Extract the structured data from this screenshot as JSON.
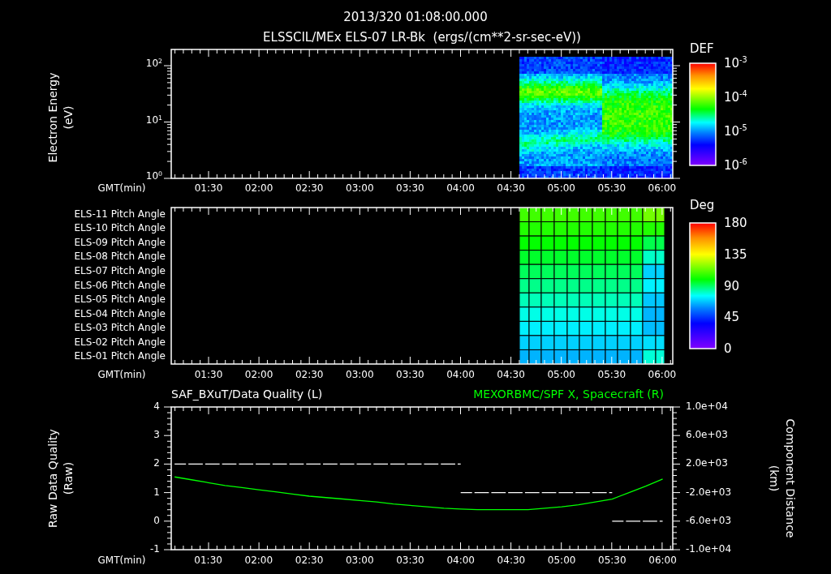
{
  "header": {
    "time": "2013/320 01:08:00.000"
  },
  "energy_panel": {
    "title": "ELSSCIL/MEx ELS-07 LR-Bk  (ergs/(cm**2-sr-sec-eV))",
    "ylabel": "Electron Energy",
    "yunit": "(eV)",
    "yticks": [
      "10$^{2}$",
      "10$^{1}$",
      "10$^{0}$"
    ],
    "xlabel": "GMT(min)",
    "xticks": [
      "01:30",
      "02:00",
      "02:30",
      "03:00",
      "03:30",
      "04:00",
      "04:30",
      "05:00",
      "05:30",
      "06:00"
    ],
    "colorbar": {
      "title": "DEF",
      "ticks": [
        "10$^{-3}$",
        "10$^{-4}$",
        "10$^{-5}$",
        "10$^{-6}$"
      ]
    }
  },
  "pitch_panel": {
    "rows": [
      "ELS-11 Pitch Angle",
      "ELS-10 Pitch Angle",
      "ELS-09 Pitch Angle",
      "ELS-08 Pitch Angle",
      "ELS-07 Pitch Angle",
      "ELS-06 Pitch Angle",
      "ELS-05 Pitch Angle",
      "ELS-04 Pitch Angle",
      "ELS-03 Pitch Angle",
      "ELS-02 Pitch Angle",
      "ELS-01 Pitch Angle"
    ],
    "xlabel": "GMT(min)",
    "xticks": [
      "01:30",
      "02:00",
      "02:30",
      "03:00",
      "03:30",
      "04:00",
      "04:30",
      "05:00",
      "05:30",
      "06:00"
    ],
    "colorbar": {
      "title": "Deg",
      "ticks": [
        "180",
        "135",
        "90",
        "45",
        "0"
      ]
    }
  },
  "quality_panel": {
    "left": {
      "unit": "(Raw)",
      "chart_data": {
        "type": "line",
        "xlabel": "GMT(min)",
        "ylabel": "Raw Data Quality",
        "x": [
          70,
          80,
          90,
          100,
          110,
          120,
          130,
          140,
          150,
          160,
          170,
          180,
          190,
          200,
          210,
          220,
          230,
          240,
          250,
          260,
          270,
          280,
          290,
          300,
          310,
          320,
          330,
          340,
          350
        ],
        "xlim": [
          68,
          366
        ],
        "ylim": [
          -1,
          4
        ],
        "xticks": [
          {
            "value": 90,
            "label": "01:30"
          },
          {
            "value": 120,
            "label": "02:00"
          },
          {
            "value": 150,
            "label": "02:30"
          },
          {
            "value": 180,
            "label": "03:00"
          },
          {
            "value": 210,
            "label": "03:30"
          },
          {
            "value": 240,
            "label": "04:00"
          },
          {
            "value": 270,
            "label": "04:30"
          },
          {
            "value": 300,
            "label": "05:00"
          },
          {
            "value": 330,
            "label": "05:30"
          },
          {
            "value": 360,
            "label": "06:00"
          }
        ],
        "yticks": [
          4,
          3,
          2,
          1,
          0,
          -1
        ],
        "series": [
          {
            "name": "SAF_BXuT/Data Quality (L)",
            "color": "#ffffff",
            "line_style": "dashed",
            "values": [
              2,
              2,
              2,
              2,
              2,
              2,
              2,
              2,
              2,
              2,
              2,
              2,
              2,
              2,
              2,
              2,
              2,
              1,
              1,
              1,
              1,
              1,
              1,
              1,
              1,
              1,
              0,
              0,
              0
            ]
          }
        ]
      }
    },
    "right": {
      "unit": "(km)",
      "chart_data": {
        "type": "line",
        "ylabel": "Component Distance",
        "x": [
          70,
          80,
          90,
          100,
          110,
          120,
          130,
          140,
          150,
          160,
          170,
          180,
          190,
          200,
          210,
          220,
          230,
          240,
          250,
          260,
          270,
          280,
          290,
          300,
          310,
          320,
          330,
          340,
          350,
          360
        ],
        "xlim": [
          68,
          366
        ],
        "ylim": [
          -10000,
          10000
        ],
        "yticks": [
          {
            "value": 10000,
            "label": "1.0e+04"
          },
          {
            "value": 6000,
            "label": "6.0e+03"
          },
          {
            "value": 2000,
            "label": "2.0e+03"
          },
          {
            "value": -2000,
            "label": "-2.0e+03"
          },
          {
            "value": -6000,
            "label": "-6.0e+03"
          },
          {
            "value": -10000,
            "label": "-1.0e+04"
          }
        ],
        "series": [
          {
            "name": "MEXORBMC/SPF X, Spacecraft (R)",
            "color": "#00ff00",
            "line_style": "solid",
            "values": [
              200,
              -200,
              -600,
              -1000,
              -1300,
              -1600,
              -1900,
              -2200,
              -2500,
              -2700,
              -2900,
              -3100,
              -3300,
              -3600,
              -3800,
              -4000,
              -4200,
              -4300,
              -4400,
              -4400,
              -4400,
              -4400,
              -4200,
              -4000,
              -3700,
              -3300,
              -2900,
              -2000,
              -1100,
              -100
            ]
          }
        ]
      }
    }
  }
}
